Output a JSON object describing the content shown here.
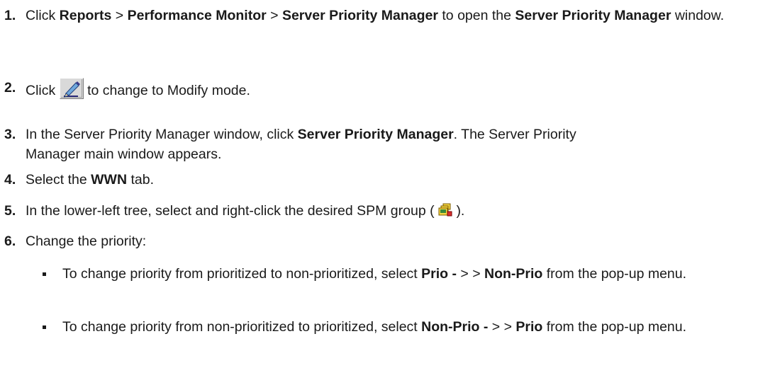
{
  "steps": [
    {
      "number": "1.",
      "parts": [
        {
          "t": "Click ",
          "b": false
        },
        {
          "t": "Reports",
          "b": true
        },
        {
          "t": " > ",
          "b": false
        },
        {
          "t": "Performance Monitor",
          "b": true
        },
        {
          "t": " > ",
          "b": false
        },
        {
          "t": "Server Priority Manager",
          "b": true
        },
        {
          "t": " to open the ",
          "b": false
        },
        {
          "t": "Server Priority Manager",
          "b": true
        },
        {
          "t": " window.",
          "b": false
        }
      ]
    },
    {
      "number": "2.",
      "before_icon": "Click ",
      "icon": "modify-mode-pencil-icon",
      "after_icon": " to change to Modify mode."
    },
    {
      "number": "3.",
      "parts": [
        {
          "t": "In the Server Priority Manager window, click ",
          "b": false
        },
        {
          "t": "Server Priority Manager",
          "b": true
        },
        {
          "t": ". The Server Priority Manager main window appears.",
          "b": false
        }
      ]
    },
    {
      "number": "4.",
      "parts": [
        {
          "t": "Select the ",
          "b": false
        },
        {
          "t": "WWN",
          "b": true
        },
        {
          "t": " tab.",
          "b": false
        }
      ]
    },
    {
      "number": "5.",
      "before_icon": "In the lower-left tree, select and right-click the desired SPM group ( ",
      "icon": "spm-group-icon",
      "after_icon": " )."
    },
    {
      "number": "6.",
      "parts": [
        {
          "t": "Change the priority:",
          "b": false
        }
      ]
    }
  ],
  "substeps": [
    {
      "parts": [
        {
          "t": "To change priority from prioritized to non-prioritized, select ",
          "b": false
        },
        {
          "t": "Prio -",
          "b": true
        },
        {
          "t": " > > ",
          "b": false
        },
        {
          "t": "Non-Prio",
          "b": true
        },
        {
          "t": " from the pop-up menu.",
          "b": false
        }
      ]
    },
    {
      "parts": [
        {
          "t": "To change priority from non-prioritized to prioritized, select ",
          "b": false
        },
        {
          "t": "Non-Prio -",
          "b": true
        },
        {
          "t": " > > ",
          "b": false
        },
        {
          "t": "Prio",
          "b": true
        },
        {
          "t": " from the pop-up menu.",
          "b": false
        }
      ]
    }
  ]
}
